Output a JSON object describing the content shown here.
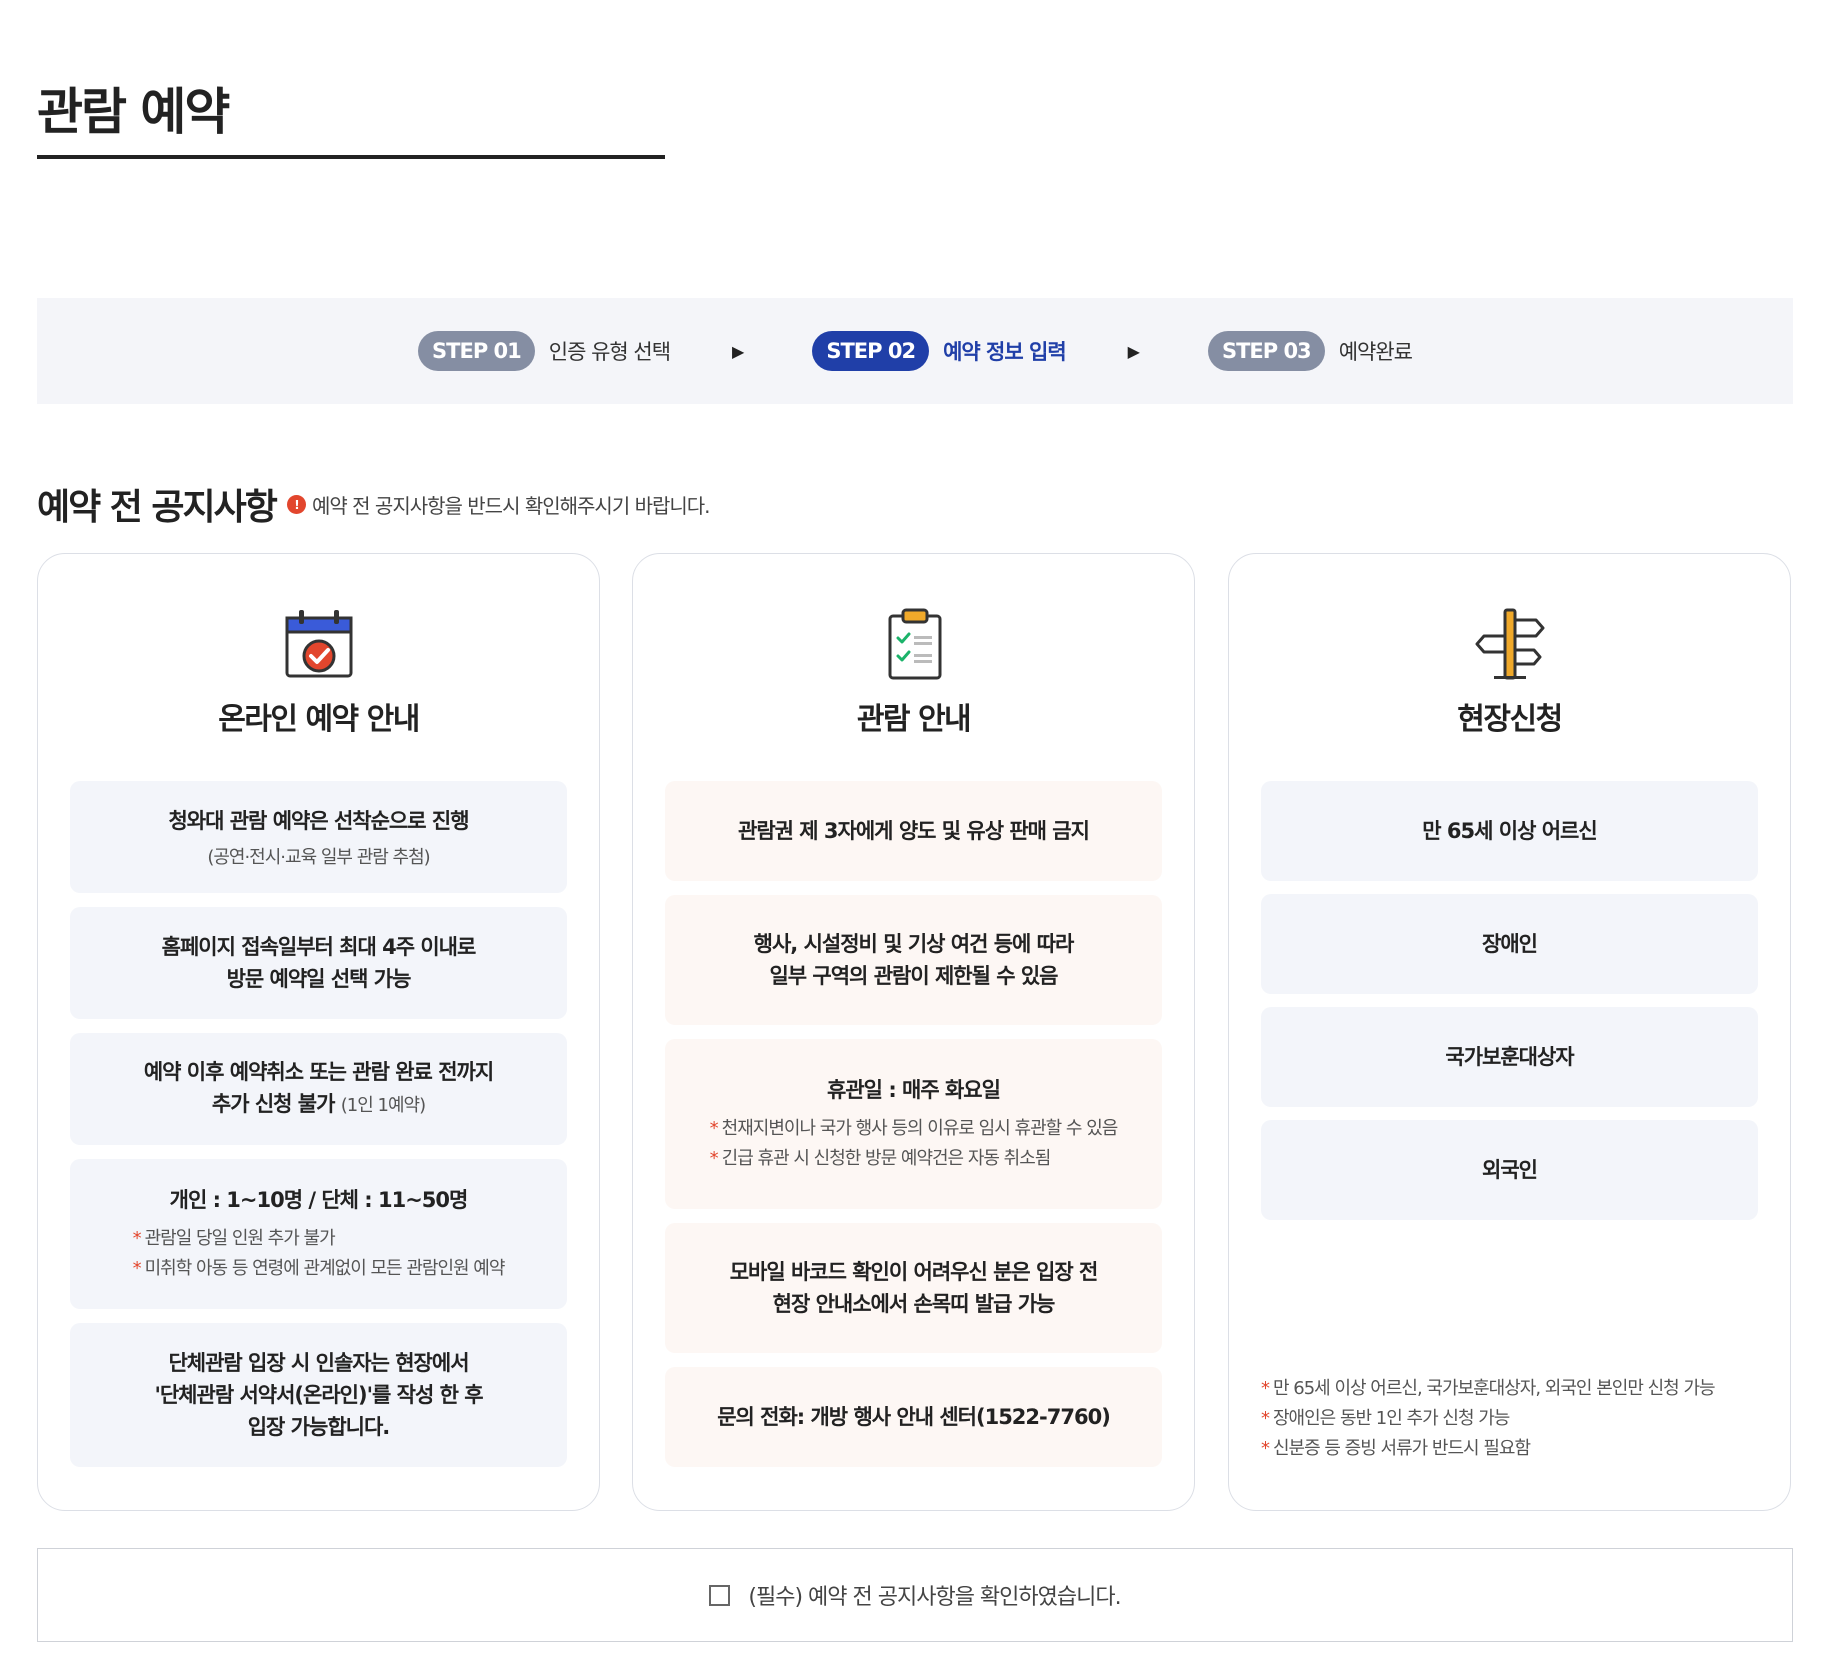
{
  "page": {
    "title": "관람 예약"
  },
  "stepper": {
    "steps": [
      {
        "badge": "STEP 01",
        "label": "인증 유형 선택",
        "active": false
      },
      {
        "badge": "STEP 02",
        "label": "예약 정보 입력",
        "active": true
      },
      {
        "badge": "STEP 03",
        "label": "예약완료",
        "active": false
      }
    ],
    "arrow": "▶"
  },
  "notice": {
    "title": "예약 전 공지사항",
    "info_icon": "!",
    "note": "예약 전 공지사항을 반드시 확인해주시기 바랍니다."
  },
  "cards": [
    {
      "icon": "calendar-check-icon",
      "title": "온라인 예약 안내",
      "items": [
        {
          "lines": [
            "청와대 관람 예약은 선착순으로 진행"
          ],
          "sub": "(공연·전시·교육 일부 관람 추첨)"
        },
        {
          "lines": [
            "홈페이지 접속일부터 최대 4주 이내로",
            "방문 예약일 선택 가능"
          ]
        },
        {
          "lines": [
            "예약 이후 예약취소 또는 관람 완료 전까지",
            "추가 신청 불가"
          ],
          "light": "(1인 1예약)"
        },
        {
          "lines": [
            "개인 : 1~10명 / 단체 : 11~50명"
          ],
          "notes": [
            "관람일 당일 인원 추가 불가",
            "미취학 아동 등 연령에 관계없이 모든 관람인원 예약"
          ]
        },
        {
          "lines": [
            "단체관람 입장 시 인솔자는 현장에서",
            "'단체관람 서약서(온라인)'를 작성 한 후",
            "입장 가능합니다."
          ]
        }
      ]
    },
    {
      "icon": "clipboard-checklist-icon",
      "title": "관람 안내",
      "items": [
        {
          "lines": [
            "관람권 제 3자에게 양도 및 유상 판매 금지"
          ]
        },
        {
          "lines": [
            "행사, 시설정비 및 기상 여건 등에 따라",
            "일부 구역의 관람이 제한될 수 있음"
          ]
        },
        {
          "lines": [
            "휴관일 : 매주 화요일"
          ],
          "notes": [
            "천재지변이나 국가 행사 등의 이유로 임시 휴관할 수 있음",
            "긴급 휴관 시 신청한 방문 예약건은 자동 취소됨"
          ]
        },
        {
          "lines": [
            "모바일 바코드 확인이 어려우신 분은 입장 전",
            "현장 안내소에서 손목띠 발급 가능"
          ]
        },
        {
          "lines": [
            "문의 전화: 개방 행사 안내 센터(1522-7760)"
          ]
        }
      ]
    },
    {
      "icon": "signpost-icon",
      "title": "현장신청",
      "items": [
        {
          "lines": [
            "만 65세 이상 어르신"
          ]
        },
        {
          "lines": [
            "장애인"
          ]
        },
        {
          "lines": [
            "국가보훈대상자"
          ]
        },
        {
          "lines": [
            "외국인"
          ]
        }
      ],
      "notes": [
        "만 65세 이상 어르신, 국가보훈대상자, 외국인 본인만 신청 가능",
        "장애인은 동반 1인 추가 신청 가능",
        "신분증 등 증빙 서류가 반드시 필요함"
      ]
    }
  ],
  "agreement": {
    "label": "(필수) 예약 전 공지사항을 확인하였습니다."
  },
  "colors": {
    "accent": "#203fa8",
    "step_inactive": "#858ea3",
    "alert": "#e2462d",
    "box_blue": "#f3f5fa",
    "box_peach": "#fdf7f4"
  }
}
